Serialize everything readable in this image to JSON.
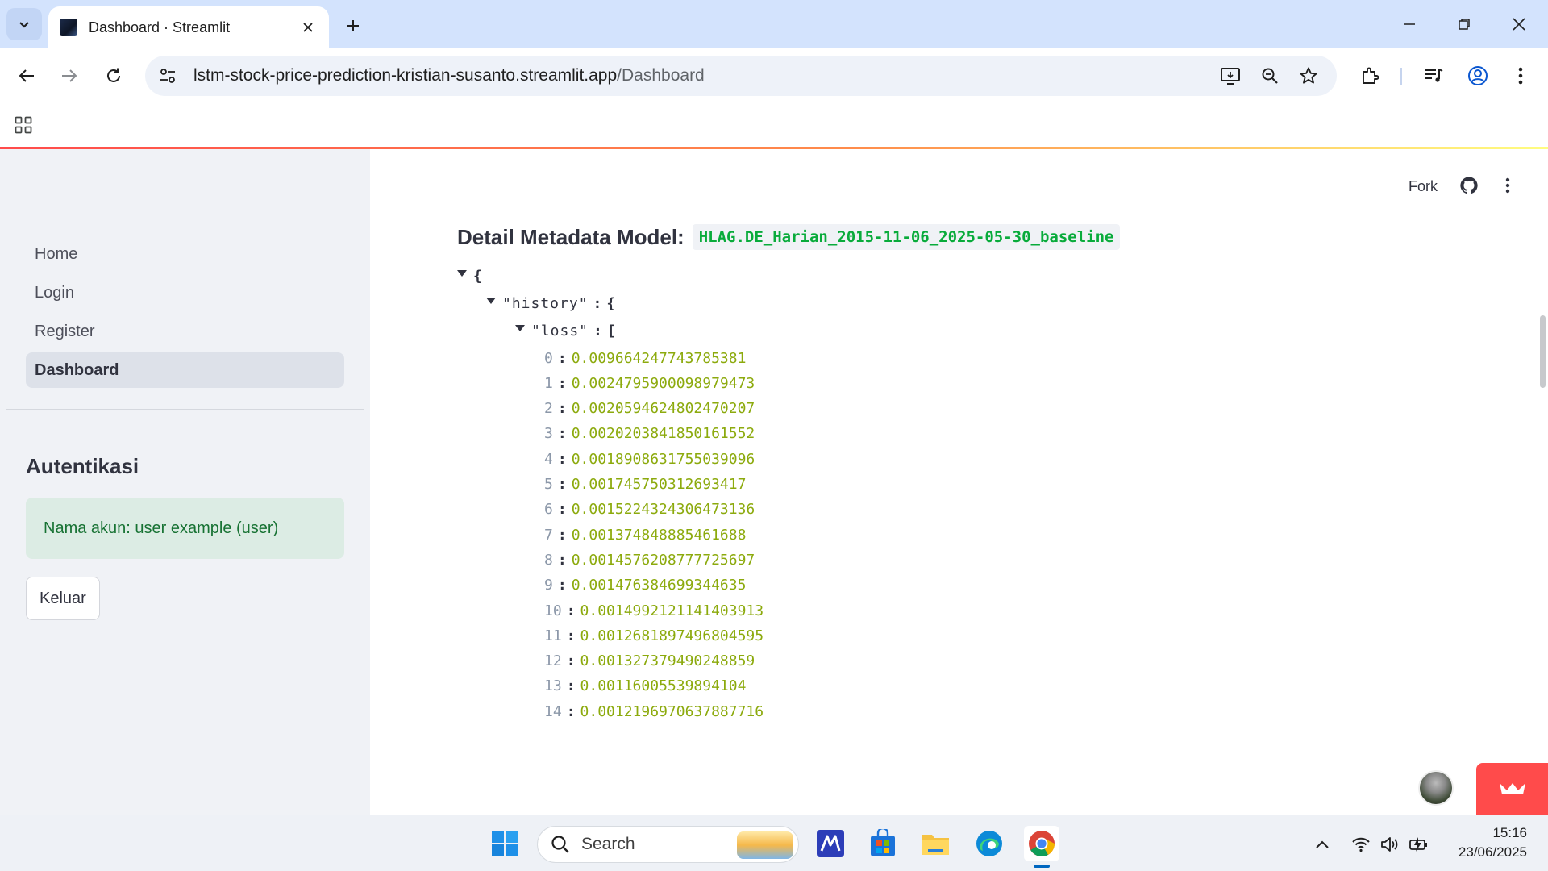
{
  "browser": {
    "tab_title": "Dashboard · Streamlit",
    "url_host": "lstm-stock-price-prediction-kristian-susanto.streamlit.app",
    "url_path": "/Dashboard"
  },
  "sidebar": {
    "nav": [
      {
        "label": "Home",
        "active": false
      },
      {
        "label": "Login",
        "active": false
      },
      {
        "label": "Register",
        "active": false
      },
      {
        "label": "Dashboard",
        "active": true
      }
    ],
    "auth_heading": "Autentikasi",
    "account_message": "Nama akun: user example (user)",
    "logout_label": "Keluar"
  },
  "header": {
    "fork_label": "Fork"
  },
  "main": {
    "subheader": "Detail Metadata Model:",
    "model_name": "HLAG.DE_Harian_2015-11-06_2025-05-30_baseline",
    "json": {
      "open_brace": "{",
      "history_key": "\"history\"",
      "loss_key": "\"loss\"",
      "colon": ":",
      "obj_open": "{",
      "arr_open": "[",
      "loss_values": [
        {
          "i": "0",
          "v": "0.009664247743785381"
        },
        {
          "i": "1",
          "v": "0.0024795900098979473"
        },
        {
          "i": "2",
          "v": "0.0020594624802470207"
        },
        {
          "i": "3",
          "v": "0.0020203841850161552"
        },
        {
          "i": "4",
          "v": "0.0018908631755039096"
        },
        {
          "i": "5",
          "v": "0.001745750312693417"
        },
        {
          "i": "6",
          "v": "0.0015224324306473136"
        },
        {
          "i": "7",
          "v": "0.001374848885461688"
        },
        {
          "i": "8",
          "v": "0.0014576208777725697"
        },
        {
          "i": "9",
          "v": "0.001476384699344635"
        },
        {
          "i": "10",
          "v": "0.0014992121141403913"
        },
        {
          "i": "11",
          "v": "0.0012681897496804595"
        },
        {
          "i": "12",
          "v": "0.001327379490248859"
        },
        {
          "i": "13",
          "v": "0.00116005539894104"
        },
        {
          "i": "14",
          "v": "0.0012196970637887716"
        }
      ]
    }
  },
  "taskbar": {
    "search_label": "Search",
    "time": "15:16",
    "date": "23/06/2025"
  },
  "colors": {
    "streamlit_red": "#ff4b4b",
    "json_number": "#8caa0d",
    "json_index": "#8c98a9",
    "code_green": "#09ab3b",
    "success_bg": "#dcece4"
  },
  "icons": [
    "chevron-down-icon",
    "close-icon",
    "plus-icon",
    "minimize-icon",
    "restore-icon",
    "back-icon",
    "forward-icon",
    "reload-icon",
    "site-info-icon",
    "install-app-icon",
    "zoom-icon",
    "star-icon",
    "extensions-icon",
    "media-icon",
    "profile-icon",
    "kebab-menu-icon",
    "apps-grid-icon",
    "github-icon",
    "crown-icon",
    "windows-logo-icon",
    "search-icon",
    "wifi-icon",
    "volume-icon",
    "battery-icon"
  ]
}
